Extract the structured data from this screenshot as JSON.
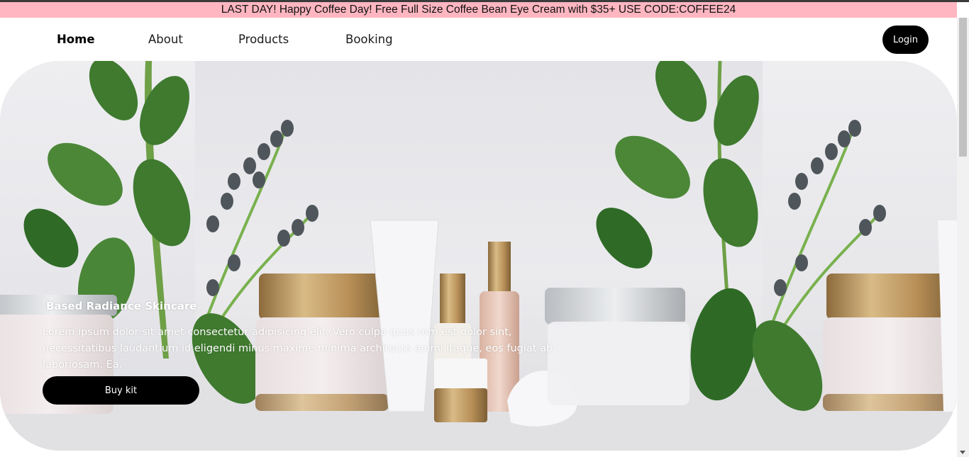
{
  "promo": {
    "text": "LAST DAY! Happy Coffee Day! Free Full Size Coffee Bean Eye Cream with $35+ USE CODE:COFFEE24",
    "background": "#ffb6c1"
  },
  "nav": {
    "items": [
      {
        "label": "Home",
        "active": true
      },
      {
        "label": "About"
      },
      {
        "label": "Products"
      },
      {
        "label": "Booking"
      }
    ],
    "login_label": "Login"
  },
  "hero": {
    "title": "Based Radiance Skincare",
    "text": "Lorem ipsum dolor sit amet consectetur adipisicing elit. Vero culpa quos rem est dolor sint, necessitatibus laudantium id eligendi minus maxime minima architecto animi itaque, eos fugiat ab laboriosam. Ea.",
    "button_label": "Buy kit",
    "image_icon": "skincare-products-with-leaves-image"
  },
  "colors": {
    "accent": "#000000",
    "leaf": "#3f7a2f",
    "gold": "#c6a36b"
  }
}
